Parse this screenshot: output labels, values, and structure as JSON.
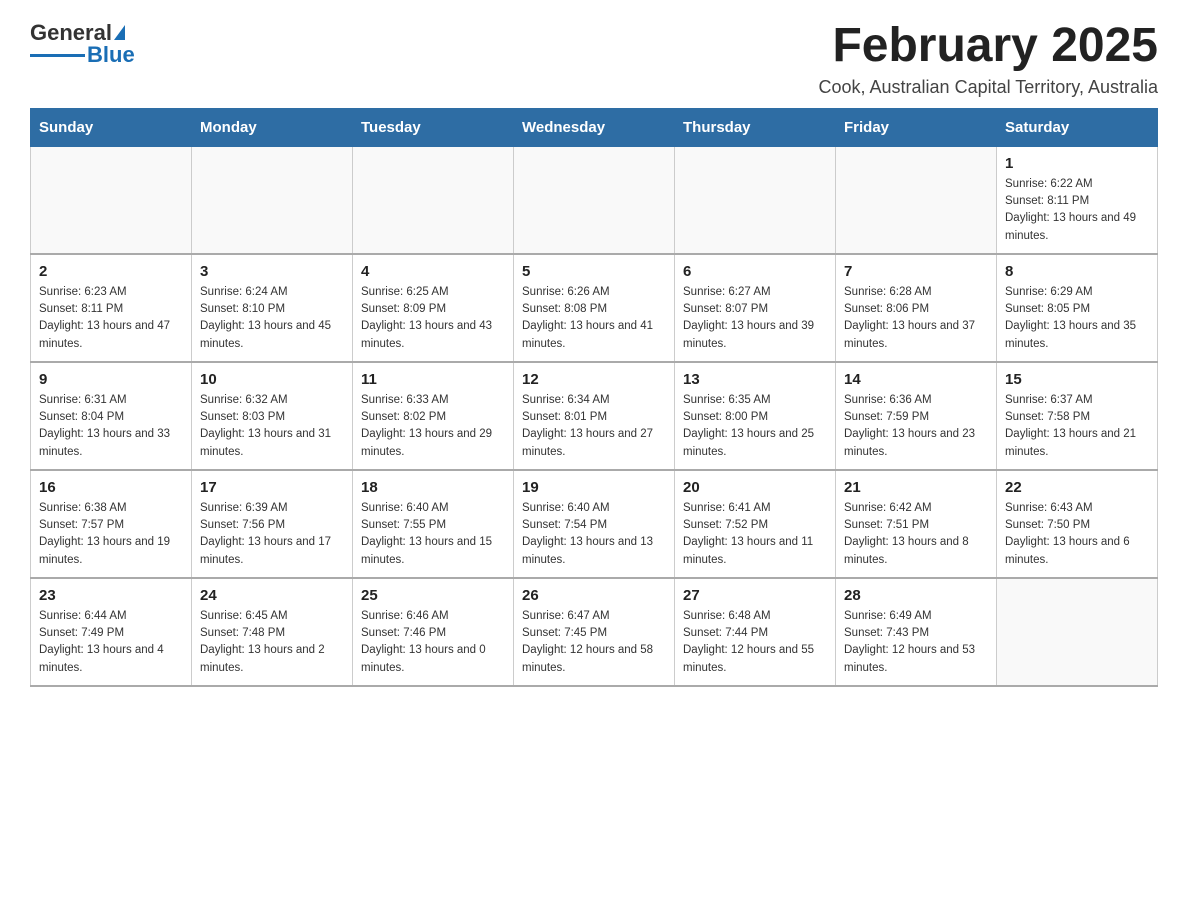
{
  "header": {
    "logo_general": "General",
    "logo_blue": "Blue",
    "title": "February 2025",
    "subtitle": "Cook, Australian Capital Territory, Australia"
  },
  "days_of_week": [
    "Sunday",
    "Monday",
    "Tuesday",
    "Wednesday",
    "Thursday",
    "Friday",
    "Saturday"
  ],
  "weeks": [
    [
      {
        "day": "",
        "info": ""
      },
      {
        "day": "",
        "info": ""
      },
      {
        "day": "",
        "info": ""
      },
      {
        "day": "",
        "info": ""
      },
      {
        "day": "",
        "info": ""
      },
      {
        "day": "",
        "info": ""
      },
      {
        "day": "1",
        "info": "Sunrise: 6:22 AM\nSunset: 8:11 PM\nDaylight: 13 hours and 49 minutes."
      }
    ],
    [
      {
        "day": "2",
        "info": "Sunrise: 6:23 AM\nSunset: 8:11 PM\nDaylight: 13 hours and 47 minutes."
      },
      {
        "day": "3",
        "info": "Sunrise: 6:24 AM\nSunset: 8:10 PM\nDaylight: 13 hours and 45 minutes."
      },
      {
        "day": "4",
        "info": "Sunrise: 6:25 AM\nSunset: 8:09 PM\nDaylight: 13 hours and 43 minutes."
      },
      {
        "day": "5",
        "info": "Sunrise: 6:26 AM\nSunset: 8:08 PM\nDaylight: 13 hours and 41 minutes."
      },
      {
        "day": "6",
        "info": "Sunrise: 6:27 AM\nSunset: 8:07 PM\nDaylight: 13 hours and 39 minutes."
      },
      {
        "day": "7",
        "info": "Sunrise: 6:28 AM\nSunset: 8:06 PM\nDaylight: 13 hours and 37 minutes."
      },
      {
        "day": "8",
        "info": "Sunrise: 6:29 AM\nSunset: 8:05 PM\nDaylight: 13 hours and 35 minutes."
      }
    ],
    [
      {
        "day": "9",
        "info": "Sunrise: 6:31 AM\nSunset: 8:04 PM\nDaylight: 13 hours and 33 minutes."
      },
      {
        "day": "10",
        "info": "Sunrise: 6:32 AM\nSunset: 8:03 PM\nDaylight: 13 hours and 31 minutes."
      },
      {
        "day": "11",
        "info": "Sunrise: 6:33 AM\nSunset: 8:02 PM\nDaylight: 13 hours and 29 minutes."
      },
      {
        "day": "12",
        "info": "Sunrise: 6:34 AM\nSunset: 8:01 PM\nDaylight: 13 hours and 27 minutes."
      },
      {
        "day": "13",
        "info": "Sunrise: 6:35 AM\nSunset: 8:00 PM\nDaylight: 13 hours and 25 minutes."
      },
      {
        "day": "14",
        "info": "Sunrise: 6:36 AM\nSunset: 7:59 PM\nDaylight: 13 hours and 23 minutes."
      },
      {
        "day": "15",
        "info": "Sunrise: 6:37 AM\nSunset: 7:58 PM\nDaylight: 13 hours and 21 minutes."
      }
    ],
    [
      {
        "day": "16",
        "info": "Sunrise: 6:38 AM\nSunset: 7:57 PM\nDaylight: 13 hours and 19 minutes."
      },
      {
        "day": "17",
        "info": "Sunrise: 6:39 AM\nSunset: 7:56 PM\nDaylight: 13 hours and 17 minutes."
      },
      {
        "day": "18",
        "info": "Sunrise: 6:40 AM\nSunset: 7:55 PM\nDaylight: 13 hours and 15 minutes."
      },
      {
        "day": "19",
        "info": "Sunrise: 6:40 AM\nSunset: 7:54 PM\nDaylight: 13 hours and 13 minutes."
      },
      {
        "day": "20",
        "info": "Sunrise: 6:41 AM\nSunset: 7:52 PM\nDaylight: 13 hours and 11 minutes."
      },
      {
        "day": "21",
        "info": "Sunrise: 6:42 AM\nSunset: 7:51 PM\nDaylight: 13 hours and 8 minutes."
      },
      {
        "day": "22",
        "info": "Sunrise: 6:43 AM\nSunset: 7:50 PM\nDaylight: 13 hours and 6 minutes."
      }
    ],
    [
      {
        "day": "23",
        "info": "Sunrise: 6:44 AM\nSunset: 7:49 PM\nDaylight: 13 hours and 4 minutes."
      },
      {
        "day": "24",
        "info": "Sunrise: 6:45 AM\nSunset: 7:48 PM\nDaylight: 13 hours and 2 minutes."
      },
      {
        "day": "25",
        "info": "Sunrise: 6:46 AM\nSunset: 7:46 PM\nDaylight: 13 hours and 0 minutes."
      },
      {
        "day": "26",
        "info": "Sunrise: 6:47 AM\nSunset: 7:45 PM\nDaylight: 12 hours and 58 minutes."
      },
      {
        "day": "27",
        "info": "Sunrise: 6:48 AM\nSunset: 7:44 PM\nDaylight: 12 hours and 55 minutes."
      },
      {
        "day": "28",
        "info": "Sunrise: 6:49 AM\nSunset: 7:43 PM\nDaylight: 12 hours and 53 minutes."
      },
      {
        "day": "",
        "info": ""
      }
    ]
  ]
}
